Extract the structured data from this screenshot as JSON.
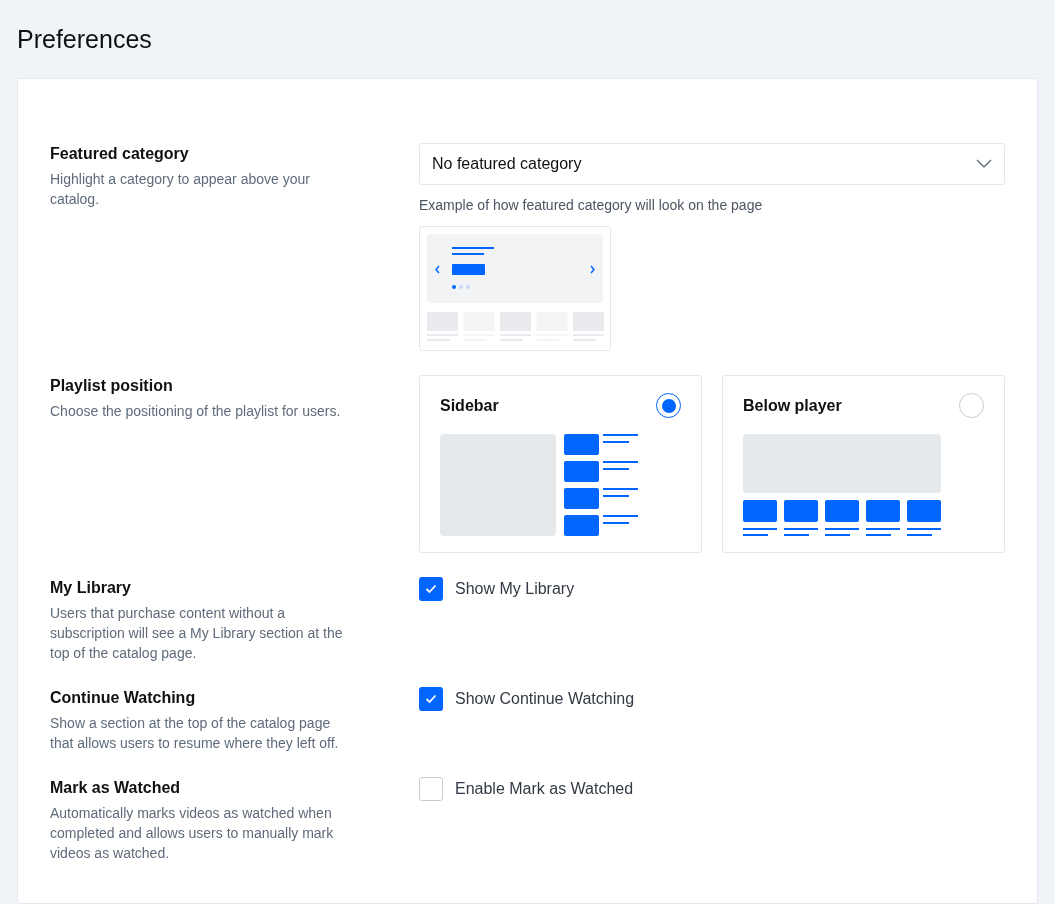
{
  "page_title": "Preferences",
  "settings": [
    {
      "kind": "select",
      "title": "Featured category",
      "description": "Highlight a category to appear above your catalog.",
      "value": "No featured category",
      "hint": "Example of how featured category will look on the page"
    },
    {
      "kind": "radio_cards",
      "title": "Playlist position",
      "description": "Choose the positioning of the playlist for users.",
      "options": [
        {
          "label": "Sidebar",
          "kind": "sidebar",
          "selected": true
        },
        {
          "label": "Below player",
          "kind": "below",
          "selected": false
        }
      ]
    },
    {
      "kind": "checkbox",
      "title": "My Library",
      "description": "Users that purchase content without a subscription will see a My Library section at the top of the catalog page.",
      "label": "Show My Library",
      "checked": true
    },
    {
      "kind": "checkbox",
      "title": "Continue Watching",
      "description": "Show a section at the top of the catalog page that allows users to resume where they left off.",
      "label": "Show Continue Watching",
      "checked": true
    },
    {
      "kind": "checkbox",
      "title": "Mark as Watched",
      "description": "Automatically marks videos as watched when completed and allows users to manually mark videos as watched.",
      "label": "Enable Mark as Watched",
      "checked": false
    }
  ]
}
